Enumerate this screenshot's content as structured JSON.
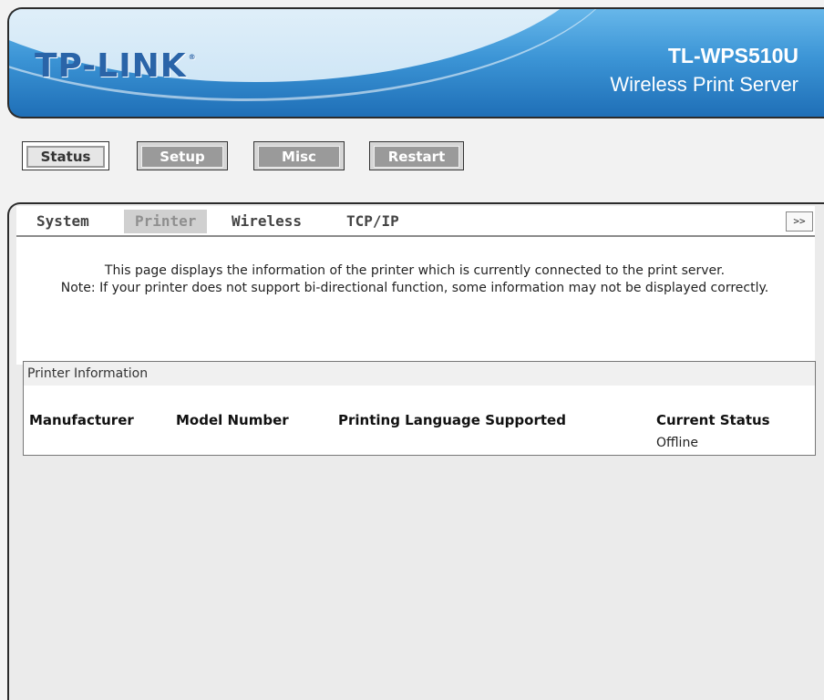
{
  "header": {
    "logo": "TP-LINK",
    "logo_mark": "®",
    "model": "TL-WPS510U",
    "product": "Wireless Print Server"
  },
  "main_nav": [
    {
      "label": "Status",
      "active": true
    },
    {
      "label": "Setup",
      "active": false
    },
    {
      "label": "Misc",
      "active": false
    },
    {
      "label": "Restart",
      "active": false
    }
  ],
  "sub_nav": {
    "tabs": [
      {
        "label": "System",
        "active": false
      },
      {
        "label": "Printer",
        "active": true
      },
      {
        "label": "Wireless",
        "active": false
      },
      {
        "label": "TCP/IP",
        "active": false
      }
    ],
    "more_label": ">>"
  },
  "info": {
    "line1": "This page displays the information of the printer which is currently connected to the print server.",
    "line2": "Note: If your printer does not support bi-directional function, some information may not be displayed correctly."
  },
  "printer_info": {
    "title": "Printer Information",
    "columns": [
      "Manufacturer",
      "Model Number",
      "Printing Language Supported",
      "Current Status"
    ],
    "row": [
      "",
      "",
      "",
      "Offline"
    ]
  },
  "colors": {
    "banner_blue": "#1f6fb7",
    "logo_blue": "#2a64a8",
    "active_tab_bg": "#d0d0d0",
    "inactive_button_bg": "#9a9a9a"
  }
}
